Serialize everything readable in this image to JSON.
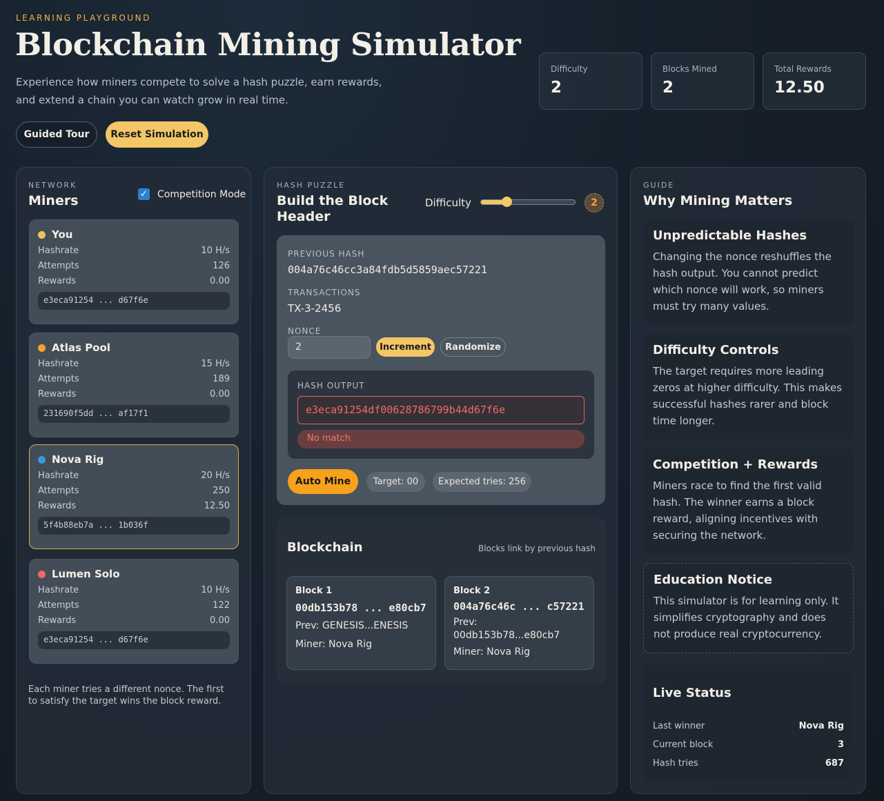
{
  "header": {
    "eyebrow": "LEARNING PLAYGROUND",
    "title": "Blockchain Mining Simulator",
    "subtitle": "Experience how miners compete to solve a hash puzzle, earn rewards, and extend a chain you can watch grow in real time.",
    "tour_label": "Guided Tour",
    "reset_label": "Reset Simulation"
  },
  "stats": [
    {
      "label": "Difficulty",
      "value": "2"
    },
    {
      "label": "Blocks Mined",
      "value": "2"
    },
    {
      "label": "Total Rewards",
      "value": "12.50"
    }
  ],
  "network": {
    "kicker": "NETWORK",
    "title": "Miners",
    "competition_label": "Competition Mode",
    "competition_checked": true,
    "row_labels": {
      "hashrate": "Hashrate",
      "attempts": "Attempts",
      "rewards": "Rewards"
    },
    "miners": [
      {
        "name": "You",
        "dot_color": "#f3c255",
        "hashrate": "10 H/s",
        "attempts": "126",
        "rewards": "0.00",
        "hash": "e3eca91254 ... d67f6e"
      },
      {
        "name": "Atlas Pool",
        "dot_color": "#f5a128",
        "hashrate": "15 H/s",
        "attempts": "189",
        "rewards": "0.00",
        "hash": "231690f5dd ... af17f1"
      },
      {
        "name": "Nova Rig",
        "dot_color": "#3a9ad9",
        "hashrate": "20 H/s",
        "attempts": "250",
        "rewards": "12.50",
        "hash": "5f4b88eb7a ... 1b036f"
      },
      {
        "name": "Lumen Solo",
        "dot_color": "#ef6a62",
        "hashrate": "10 H/s",
        "attempts": "122",
        "rewards": "0.00",
        "hash": "e3eca91254 ... d67f6e"
      }
    ],
    "footnote": "Each miner tries a different nonce. The first to satisfy the target wins the block reward."
  },
  "puzzle": {
    "kicker": "HASH PUZZLE",
    "title": "Build the Block Header",
    "difficulty_label": "Difficulty",
    "difficulty_value": "2",
    "difficulty_slider_fraction": 0.25,
    "prev_hash_label": "PREVIOUS HASH",
    "prev_hash": "004a76c46cc3a84fdb5d5859aec57221",
    "transactions_label": "TRANSACTIONS",
    "transactions": "TX-3-2456",
    "nonce_label": "NONCE",
    "nonce_value": "2",
    "increment_label": "Increment",
    "randomize_label": "Randomize",
    "hash_output_label": "HASH OUTPUT",
    "hash_output": "e3eca91254df00628786799b44d67f6e",
    "match_status": "No match",
    "auto_mine_label": "Auto Mine",
    "target": "Target: 00",
    "expected_tries": "Expected tries: 256"
  },
  "blockchain": {
    "title": "Blockchain",
    "note": "Blocks link by previous hash",
    "blocks": [
      {
        "title": "Block 1",
        "hash": "00db153b78 ... e80cb7",
        "prev": "Prev: GENESIS...ENESIS",
        "miner": "Miner: Nova Rig"
      },
      {
        "title": "Block 2",
        "hash": "004a76c46c ... c57221",
        "prev": "Prev: 00db153b78...e80cb7",
        "miner": "Miner: Nova Rig"
      }
    ]
  },
  "guide": {
    "kicker": "GUIDE",
    "title": "Why Mining Matters",
    "cards": [
      {
        "title": "Unpredictable Hashes",
        "text": "Changing the nonce reshuffles the hash output. You cannot predict which nonce will work, so miners must try many values."
      },
      {
        "title": "Difficulty Controls",
        "text": "The target requires more leading zeros at higher difficulty. This makes successful hashes rarer and block time longer."
      },
      {
        "title": "Competition + Rewards",
        "text": "Miners race to find the first valid hash. The winner earns a block reward, aligning incentives with securing the network."
      },
      {
        "title": "Education Notice",
        "text": "This simulator is for learning only. It simplifies cryptography and does not produce real cryptocurrency."
      }
    ],
    "live": {
      "title": "Live Status",
      "rows": [
        {
          "label": "Last winner",
          "value": "Nova Rig"
        },
        {
          "label": "Current block",
          "value": "3"
        },
        {
          "label": "Hash tries",
          "value": "687"
        }
      ]
    }
  }
}
